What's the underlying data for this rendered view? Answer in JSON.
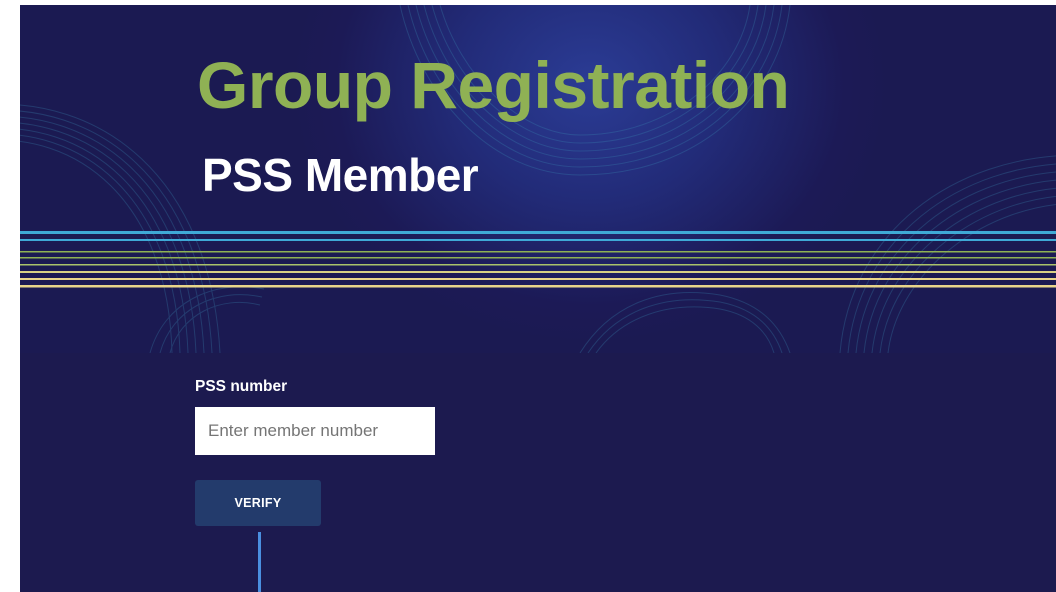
{
  "hero": {
    "title": "Group Registration",
    "subtitle": "PSS Member",
    "colors": {
      "background": "#1c1a4f",
      "title": "#8fb154",
      "subtitle": "#ffffff",
      "stripe_cyan": "#3fa9d6",
      "stripe_green": "#8fb154",
      "stripe_yellow": "#e8d58a"
    }
  },
  "form": {
    "pss_number": {
      "label": "PSS number",
      "value": "",
      "placeholder": "Enter member number"
    },
    "verify_button": {
      "label": "VERIFY",
      "color": "#233b6c"
    }
  }
}
